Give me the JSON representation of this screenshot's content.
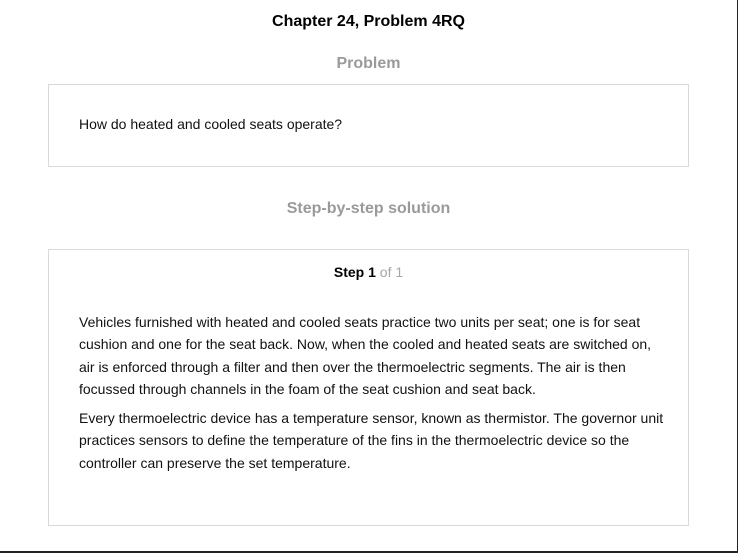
{
  "page": {
    "title": "Chapter 24, Problem 4RQ"
  },
  "problem": {
    "heading": "Problem",
    "text": "How do heated and cooled seats operate?"
  },
  "solution": {
    "heading": "Step-by-step solution",
    "step": {
      "word": "Step",
      "number": "1",
      "of_text": "of 1"
    },
    "paragraphs": [
      "Vehicles furnished with heated and cooled seats practice two units per seat; one is for seat cushion and one for the seat back. Now, when the cooled and heated seats are switched on, air is enforced through a filter and then over the thermoelectric segments. The air is then focussed through channels in the foam of the seat cushion and seat back.",
      "Every thermoelectric device has a temperature sensor, known as thermistor. The governor unit practices sensors to define the temperature of the fins in the thermoelectric device so the controller can preserve the set temperature."
    ]
  },
  "colors": {
    "heading_gray": "#9a9a9a",
    "border_gray": "#d9d9d9",
    "text": "#111111"
  }
}
